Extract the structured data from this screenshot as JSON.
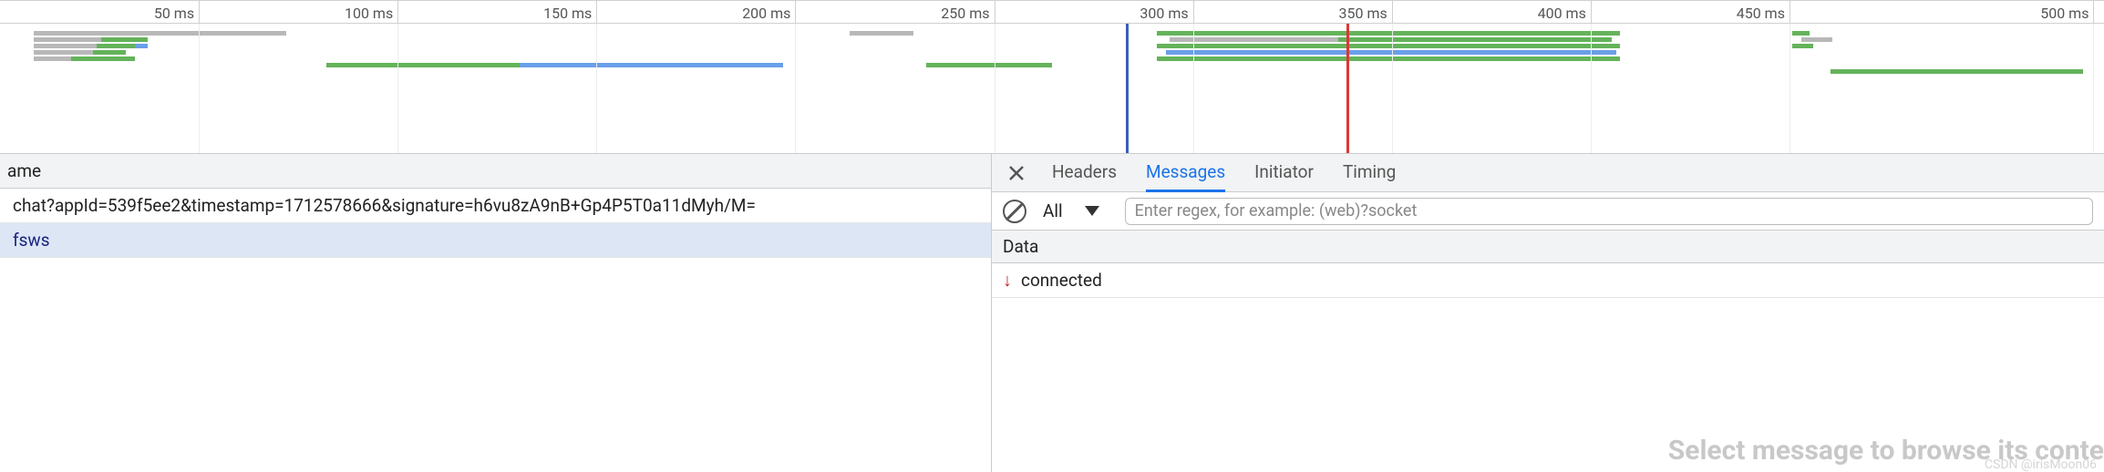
{
  "timeline": {
    "ticks": [
      {
        "label": "50 ms",
        "pct": 9.45
      },
      {
        "label": "100 ms",
        "pct": 18.9
      },
      {
        "label": "150 ms",
        "pct": 28.35
      },
      {
        "label": "200 ms",
        "pct": 37.8
      },
      {
        "label": "250 ms",
        "pct": 47.25
      },
      {
        "label": "300 ms",
        "pct": 56.7
      },
      {
        "label": "350 ms",
        "pct": 66.15
      },
      {
        "label": "400 ms",
        "pct": 75.6
      },
      {
        "label": "450 ms",
        "pct": 85.05
      },
      {
        "label": "500 ms",
        "pct": 99.5
      }
    ],
    "markers": {
      "blue_pos": 53.5,
      "red_pos": 64.0
    }
  },
  "left": {
    "header": "ame",
    "rows": [
      "chat?appId=539f5ee2&timestamp=1712578666&signature=h6vu8zA9nB+Gp4P5T0a11dMyh/M=",
      "fsws"
    ],
    "selected_index": 1
  },
  "right": {
    "tabs": [
      "Headers",
      "Messages",
      "Initiator",
      "Timing"
    ],
    "active_tab": 1,
    "filter_label": "All",
    "regex_placeholder": "Enter regex, for example: (web)?socket",
    "data_header": "Data",
    "messages": [
      {
        "dir": "down",
        "text": "connected"
      }
    ],
    "placeholder_text": "Select message to browse its conte"
  },
  "watermark": "CSDN @irisMoon06"
}
